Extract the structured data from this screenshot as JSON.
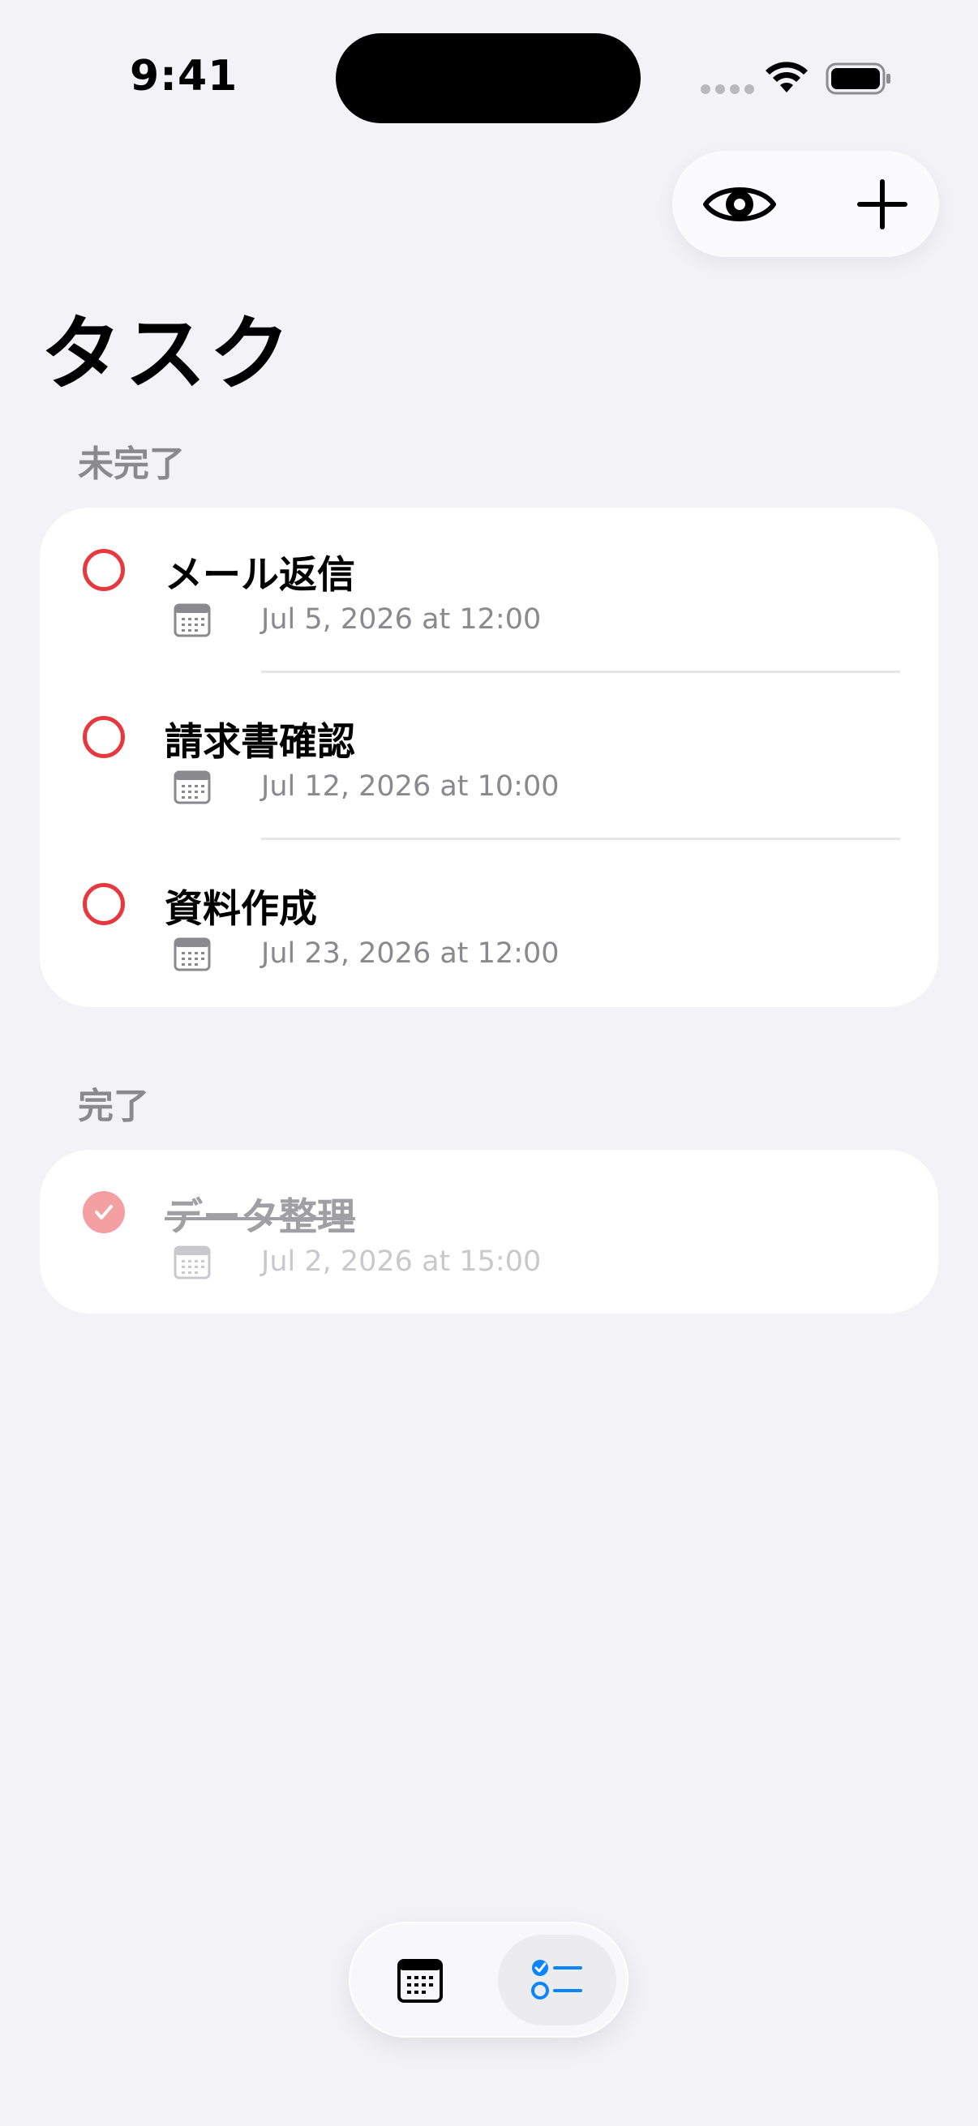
{
  "status_bar": {
    "time": "9:41"
  },
  "toolbar": {
    "eye_icon": "eye-icon",
    "add_icon": "plus-icon"
  },
  "page": {
    "title": "タスク"
  },
  "sections": [
    {
      "header": "未完了",
      "tasks": [
        {
          "title": "メール返信",
          "date": "Jul 5, 2026 at 12:00",
          "completed": false
        },
        {
          "title": "請求書確認",
          "date": "Jul 12, 2026 at 10:00",
          "completed": false
        },
        {
          "title": "資料作成",
          "date": "Jul 23, 2026 at 12:00",
          "completed": false
        }
      ]
    },
    {
      "header": "完了",
      "tasks": [
        {
          "title": "データ整理",
          "date": "Jul 2, 2026 at 15:00",
          "completed": true
        }
      ]
    }
  ],
  "tab_bar": {
    "tabs": [
      {
        "icon": "calendar-icon",
        "selected": false
      },
      {
        "icon": "checklist-icon",
        "selected": true
      }
    ]
  },
  "colors": {
    "background": "#f2f2f7",
    "accent_red": "#e5393f",
    "accent_blue": "#0a84ff",
    "secondary_text": "#8a8a8e"
  }
}
